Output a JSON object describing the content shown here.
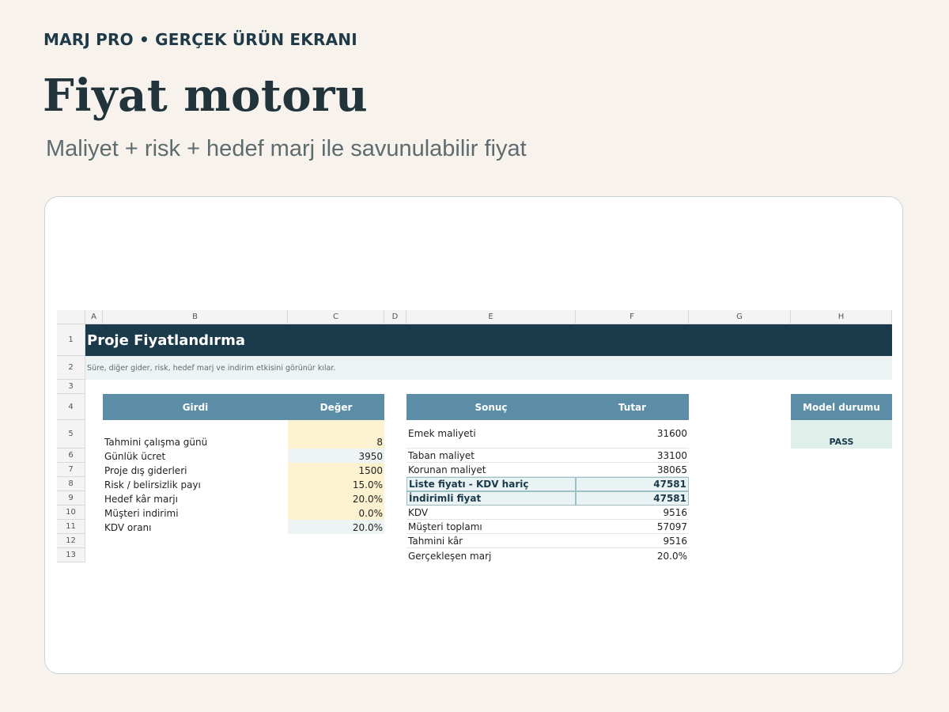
{
  "header": {
    "eyebrow": "MARJ PRO • GERÇEK ÜRÜN EKRANI",
    "title": "Fiyat motoru",
    "subtitle": "Maliyet + risk + hedef marj ile savunulabilir fiyat"
  },
  "sheet": {
    "columns": [
      "A",
      "B",
      "C",
      "D",
      "E",
      "F",
      "G",
      "H"
    ],
    "rows": [
      "1",
      "2",
      "3",
      "4",
      "5",
      "6",
      "7",
      "8",
      "9",
      "10",
      "11",
      "12",
      "13"
    ],
    "title": "Proje Fiyatlandırma",
    "note": "Süre, diğer gider, risk, hedef marj ve indirim etkisini görünür kılar.",
    "inputs_table": {
      "headers": [
        "Girdi",
        "Değer"
      ],
      "rows": [
        {
          "label": "Tahmini çalışma günü",
          "value": "8"
        },
        {
          "label": "Günlük ücret",
          "value": "3950"
        },
        {
          "label": "Proje dış giderleri",
          "value": "1500"
        },
        {
          "label": "Risk / belirsizlik payı",
          "value": "15.0%"
        },
        {
          "label": "Hedef kâr marjı",
          "value": "20.0%"
        },
        {
          "label": "Müşteri indirimi",
          "value": "0.0%"
        },
        {
          "label": "KDV oranı",
          "value": "20.0%"
        }
      ]
    },
    "results_table": {
      "headers": [
        "Sonuç",
        "Tutar"
      ],
      "rows": [
        {
          "label": "Emek maliyeti",
          "value": "31600"
        },
        {
          "label": "Taban maliyet",
          "value": "33100"
        },
        {
          "label": "Korunan maliyet",
          "value": "38065"
        },
        {
          "label": "Liste fiyatı - KDV hariç",
          "value": "47581"
        },
        {
          "label": "İndirimli fiyat",
          "value": "47581"
        },
        {
          "label": "KDV",
          "value": "9516"
        },
        {
          "label": "Müşteri toplamı",
          "value": "57097"
        },
        {
          "label": "Tahmini kâr",
          "value": "9516"
        },
        {
          "label": "Gerçekleşen marj",
          "value": "20.0%"
        }
      ]
    },
    "status": {
      "header": "Model durumu",
      "value": "PASS"
    }
  },
  "colors": {
    "banner": "#1b3a4b",
    "table_header": "#5b8ea6",
    "input_cell": "#fdf2d0",
    "pass": "#dff0ea"
  }
}
